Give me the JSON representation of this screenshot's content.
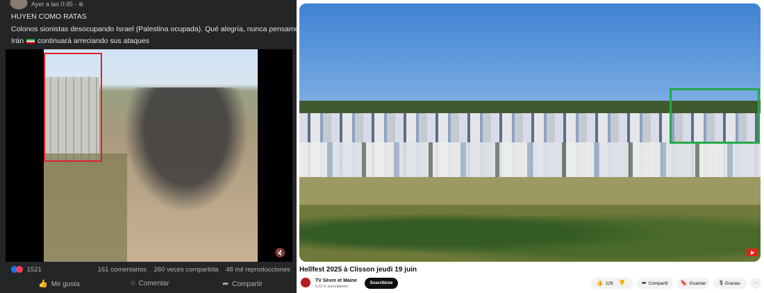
{
  "facebook_post": {
    "timestamp": "Ayer a las 0:45 · ⊕",
    "text_line1": "HUYEN COMO RATAS",
    "text_line2": "Colonos sionistas desocupando Israel (Palestina ocupada). Qué alegría, nunca pensamos ver esto.",
    "text_line3_pre": "Irán",
    "text_line3_post": "continuará arreciando sus ataques",
    "flag_icon": "iran-flag-icon",
    "reaction_count": "1521",
    "comments": "161 comentarios",
    "shares": "260 veces compartida",
    "views": "48 mil reproducciones",
    "actions": {
      "like": "Me gusta",
      "comment": "Comentar",
      "share": "Compartir"
    },
    "highlight_color": "#e0202a"
  },
  "youtube": {
    "title": "Hellfest 2025 à Clisson jeudi 19 juin",
    "channel_name": "TV Sèvre et Maine",
    "subscribers": "5,01 K suscriptores",
    "subscribe_label": "Suscribirse",
    "likes": "229",
    "share_label": "Compartir",
    "save_label": "Guardar",
    "thanks_label": "Gracias",
    "more_label": "···",
    "highlight_color": "#25a84a"
  }
}
